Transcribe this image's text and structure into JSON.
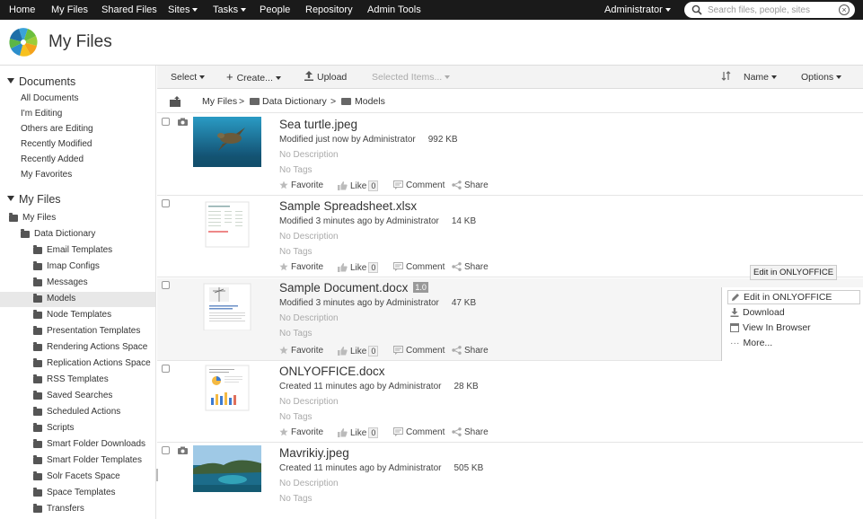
{
  "topnav": {
    "items": [
      "Home",
      "My Files",
      "Shared Files",
      "Sites",
      "Tasks",
      "People",
      "Repository",
      "Admin Tools"
    ],
    "user": "Administrator",
    "search_placeholder": "Search files, people, sites"
  },
  "header": {
    "title": "My Files"
  },
  "sidebar": {
    "documents": {
      "heading": "Documents",
      "links": [
        "All Documents",
        "I'm Editing",
        "Others are Editing",
        "Recently Modified",
        "Recently Added",
        "My Favorites"
      ]
    },
    "myfiles": {
      "heading": "My Files",
      "root": "My Files",
      "folder": "Data Dictionary",
      "children": [
        "Email Templates",
        "Imap Configs",
        "Messages",
        "Models",
        "Node Templates",
        "Presentation Templates",
        "Rendering Actions Space",
        "Replication Actions Space",
        "RSS Templates",
        "Saved Searches",
        "Scheduled Actions",
        "Scripts",
        "Smart Folder Downloads",
        "Smart Folder Templates",
        "Solr Facets Space",
        "Space Templates",
        "Transfers"
      ],
      "selected": "Models"
    }
  },
  "toolbar": {
    "select": "Select",
    "create": "Create...",
    "upload": "Upload",
    "selected_items": "Selected Items...",
    "sort": "Name",
    "options": "Options"
  },
  "breadcrumb": {
    "items": [
      "My Files",
      "Data Dictionary",
      "Models"
    ],
    "separator": ">"
  },
  "files": [
    {
      "name": "Sea turtle.jpeg",
      "meta": "Modified just now by Administrator",
      "size": "992 KB",
      "description": "No Description",
      "tags": "No Tags",
      "likes": "0"
    },
    {
      "name": "Sample Spreadsheet.xlsx",
      "meta": "Modified 3 minutes ago by Administrator",
      "size": "14 KB",
      "description": "No Description",
      "tags": "No Tags",
      "likes": "0"
    },
    {
      "name": "Sample Document.docx",
      "version": "1.0",
      "meta": "Modified 3 minutes ago by Administrator",
      "size": "47 KB",
      "description": "No Description",
      "tags": "No Tags",
      "likes": "0"
    },
    {
      "name": "ONLYOFFICE.docx",
      "meta": "Created 11 minutes ago by Administrator",
      "size": "28 KB",
      "description": "No Description",
      "tags": "No Tags",
      "likes": "0"
    },
    {
      "name": "Mavrikiy.jpeg",
      "meta": "Created 11 minutes ago by Administrator",
      "size": "505 KB",
      "description": "No Description",
      "tags": "No Tags"
    }
  ],
  "file_actions": {
    "favorite": "Favorite",
    "like": "Like",
    "comment": "Comment",
    "share": "Share"
  },
  "action_menu": {
    "tooltip": "Edit in ONLYOFFICE",
    "items": [
      "Edit in ONLYOFFICE",
      "Download",
      "View In Browser",
      "More..."
    ]
  },
  "colors": {
    "topbar": "#1a1a1a",
    "selection": "#e8e8e8",
    "hover_row": "#f5f5f5"
  }
}
